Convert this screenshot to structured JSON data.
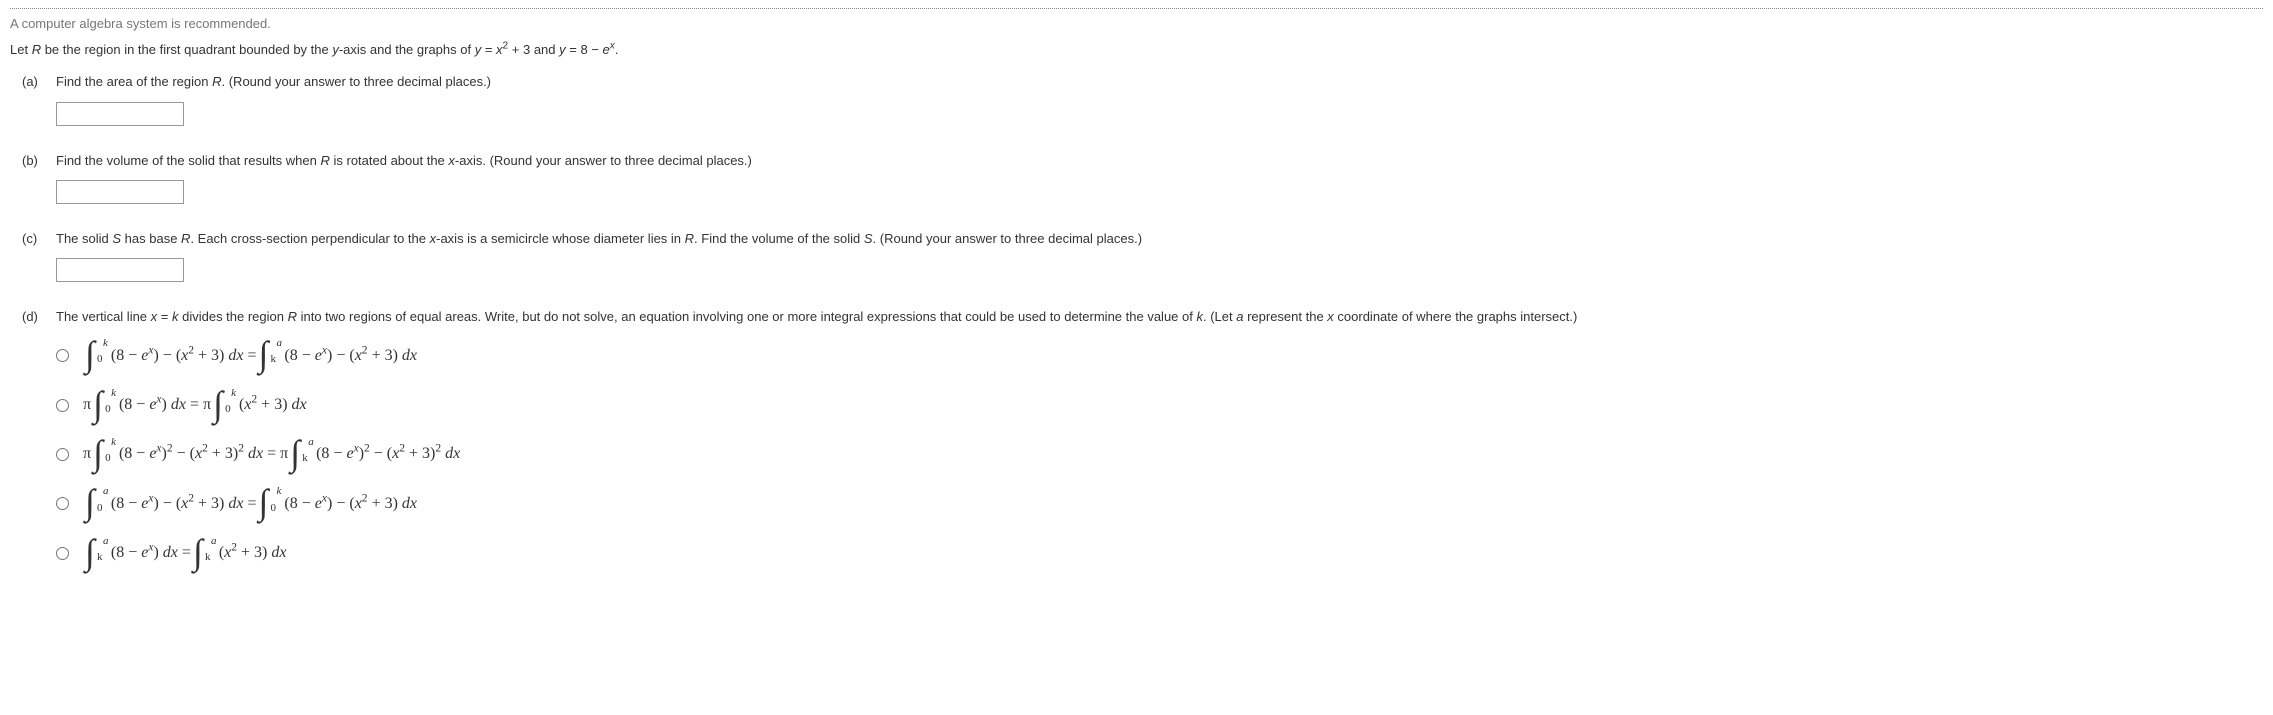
{
  "note": "A computer algebra system is recommended.",
  "stem_html": "Let <span class='italic'>R</span> be the region in the first quadrant bounded by the <span class='italic'>y</span>-axis and the graphs of <span class='italic'>y</span> = <span class='italic'>x</span><sup>2</sup> + 3 and <span class='italic'>y</span> = 8 − <span class='italic'>e</span><sup><span class='italic'>x</span></sup>.",
  "parts": {
    "a": {
      "label": "(a)",
      "text_html": "Find the area of the region <span class='italic'>R</span>. (Round your answer to three decimal places.)"
    },
    "b": {
      "label": "(b)",
      "text_html": "Find the volume of the solid that results when <span class='italic'>R</span> is rotated about the <span class='italic'>x</span>-axis. (Round your answer to three decimal places.)"
    },
    "c": {
      "label": "(c)",
      "text_html": "The solid <span class='italic'>S</span> has base <span class='italic'>R</span>. Each cross-section perpendicular to the <span class='italic'>x</span>-axis is a semicircle whose diameter lies in <span class='italic'>R</span>. Find the volume of the solid <span class='italic'>S</span>. (Round your answer to three decimal places.)"
    },
    "d": {
      "label": "(d)",
      "text_html": "The vertical line <span class='italic'>x</span> = <span class='italic'>k</span> divides the region <span class='italic'>R</span> into two regions of equal areas. Write, but do not solve, an equation involving one or more integral expressions that could be used to determine the value of <span class='italic'>k</span>. (Let <span class='italic'>a</span> represent the <span class='italic'>x</span> coordinate of where the graphs intersect.)"
    }
  },
  "choices": [
    {
      "segments": [
        {
          "type": "int",
          "lb": "0",
          "ub": "k"
        },
        {
          "type": "txt",
          "v": "(8 − <i>e</i><sup><i>x</i></sup>) − (<i>x</i><sup>2</sup> + 3) <i>dx</i> = "
        },
        {
          "type": "int",
          "lb": "k",
          "ub": "a"
        },
        {
          "type": "txt",
          "v": "(8 − <i>e</i><sup><i>x</i></sup>) − (<i>x</i><sup>2</sup> + 3) <i>dx</i>"
        }
      ]
    },
    {
      "segments": [
        {
          "type": "txt",
          "v": "π "
        },
        {
          "type": "int",
          "lb": "0",
          "ub": "k"
        },
        {
          "type": "txt",
          "v": "(8 − <i>e</i><sup><i>x</i></sup>) <i>dx</i> = π "
        },
        {
          "type": "int",
          "lb": "0",
          "ub": "k"
        },
        {
          "type": "txt",
          "v": "(<i>x</i><sup>2</sup> + 3) <i>dx</i>"
        }
      ]
    },
    {
      "segments": [
        {
          "type": "txt",
          "v": "π "
        },
        {
          "type": "int",
          "lb": "0",
          "ub": "k"
        },
        {
          "type": "txt",
          "v": "(8 − <i>e</i><sup><i>x</i></sup>)<sup>2</sup> − (<i>x</i><sup>2</sup> + 3)<sup>2</sup> <i>dx</i> = π "
        },
        {
          "type": "int",
          "lb": "k",
          "ub": "a"
        },
        {
          "type": "txt",
          "v": "(8 − <i>e</i><sup><i>x</i></sup>)<sup>2</sup> − (<i>x</i><sup>2</sup> + 3)<sup>2</sup> <i>dx</i>"
        }
      ]
    },
    {
      "segments": [
        {
          "type": "int",
          "lb": "0",
          "ub": "a"
        },
        {
          "type": "txt",
          "v": "(8 − <i>e</i><sup><i>x</i></sup>) − (<i>x</i><sup>2</sup> + 3) <i>dx</i> = "
        },
        {
          "type": "int",
          "lb": "0",
          "ub": "k"
        },
        {
          "type": "txt",
          "v": "(8 − <i>e</i><sup><i>x</i></sup>) − (<i>x</i><sup>2</sup> + 3) <i>dx</i>"
        }
      ]
    },
    {
      "segments": [
        {
          "type": "int",
          "lb": "k",
          "ub": "a"
        },
        {
          "type": "txt",
          "v": "(8 − <i>e</i><sup><i>x</i></sup>) <i>dx</i> = "
        },
        {
          "type": "int",
          "lb": "k",
          "ub": "a"
        },
        {
          "type": "txt",
          "v": "(<i>x</i><sup>2</sup> + 3) <i>dx</i>"
        }
      ]
    }
  ]
}
